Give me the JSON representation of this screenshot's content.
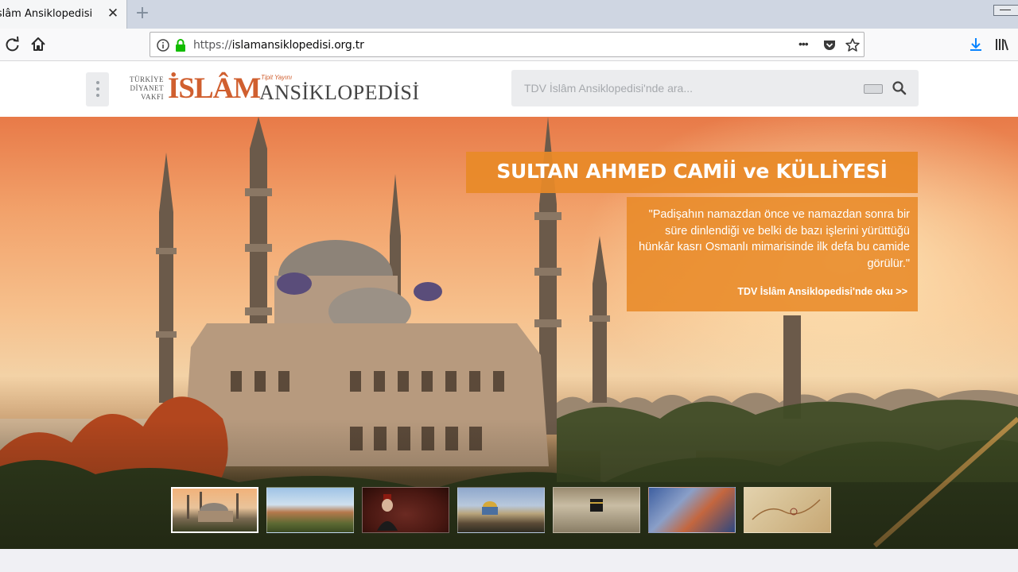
{
  "browser": {
    "tab_title": "İslâm Ansiklopedisi",
    "tab_close": "✕",
    "new_tab": "+",
    "url_scheme": "https://",
    "url_host": "islamansiklopedisi.org.tr",
    "page_actions": "•••"
  },
  "header": {
    "logo": {
      "line1": "TÜRKİYE",
      "line2": "DİYANET",
      "line3": "VAKFI",
      "islam": "İSLÂM",
      "tag": "Tipit Yayını",
      "ansiklopedisi": "ANSİKLOPEDİSİ"
    },
    "search": {
      "placeholder": "TDV İslâm Ansiklopedisi'nde ara..."
    }
  },
  "hero": {
    "title": "SULTAN AHMED CAMİİ ve KÜLLİYESİ",
    "quote": "\"Padişahın namazdan önce ve namazdan sonra bir süre dinlendiği ve belki de bazı işlerini yürüttüğü hünkâr kasrı Osmanlı mimarisinde ilk defa bu camide görülür.\"",
    "link": "TDV İslâm Ansiklopedisi'nde oku >>",
    "colors": {
      "box": "#e88a28",
      "sky_top": "#e87a48",
      "sky_mid": "#f6c08c"
    },
    "thumbnails": [
      {
        "name": "thumb-sultan-ahmed",
        "active": true
      },
      {
        "name": "thumb-alhambra",
        "active": false
      },
      {
        "name": "thumb-portrait",
        "active": false
      },
      {
        "name": "thumb-jerusalem",
        "active": false
      },
      {
        "name": "thumb-kaaba",
        "active": false
      },
      {
        "name": "thumb-miniature",
        "active": false
      },
      {
        "name": "thumb-map",
        "active": false
      }
    ]
  }
}
